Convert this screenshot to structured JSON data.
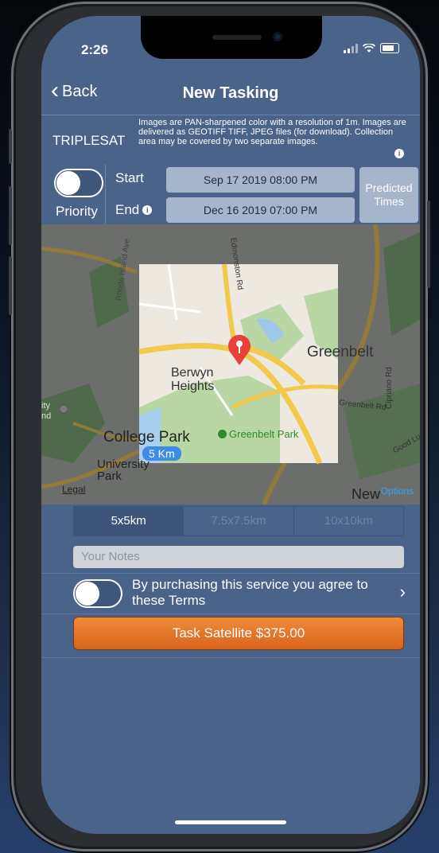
{
  "status_bar": {
    "time": "2:26"
  },
  "nav": {
    "back_label": "Back",
    "title": "New Tasking"
  },
  "info": {
    "satellite": "TRIPLESAT",
    "description": "Images are PAN-sharpened color with a resolution of 1m. Images are delivered as GEOTIFF TIFF, JPEG files (for download). Collection area may be covered by two separate images."
  },
  "schedule": {
    "priority_label": "Priority",
    "start_label": "Start",
    "end_label": "End",
    "start_value": "Sep 17 2019 08:00 PM",
    "end_value": "Dec 16 2019 07:00 PM",
    "predicted_label": "Predicted Times",
    "priority_on": false
  },
  "map": {
    "places": [
      "Greenbelt",
      "Berwyn Heights",
      "College Park",
      "University Park",
      "Greenbelt Park",
      "New"
    ],
    "roads": [
      "Rhode Island Ave",
      "Edmonston Rd",
      "Greenbelt Rd",
      "Cipriano Rd",
      "Good Luck"
    ],
    "misc": [
      "ity",
      "nd"
    ],
    "scale_label": "5 Km",
    "legal_label": "Legal",
    "options_label": "Options",
    "pin_icon": "map-pin-icon"
  },
  "sizes": {
    "options": [
      "5x5km",
      "7.5x7.5km",
      "10x10km"
    ],
    "selected": "5x5km"
  },
  "notes": {
    "placeholder": "Your Notes"
  },
  "terms": {
    "text": "By purchasing this service you agree to these Terms",
    "agreed": false
  },
  "task_button": {
    "label": "Task Satellite $375.00"
  },
  "colors": {
    "accent": "#e37a2b",
    "panel": "#4a6388",
    "link": "#2fa3ff"
  }
}
